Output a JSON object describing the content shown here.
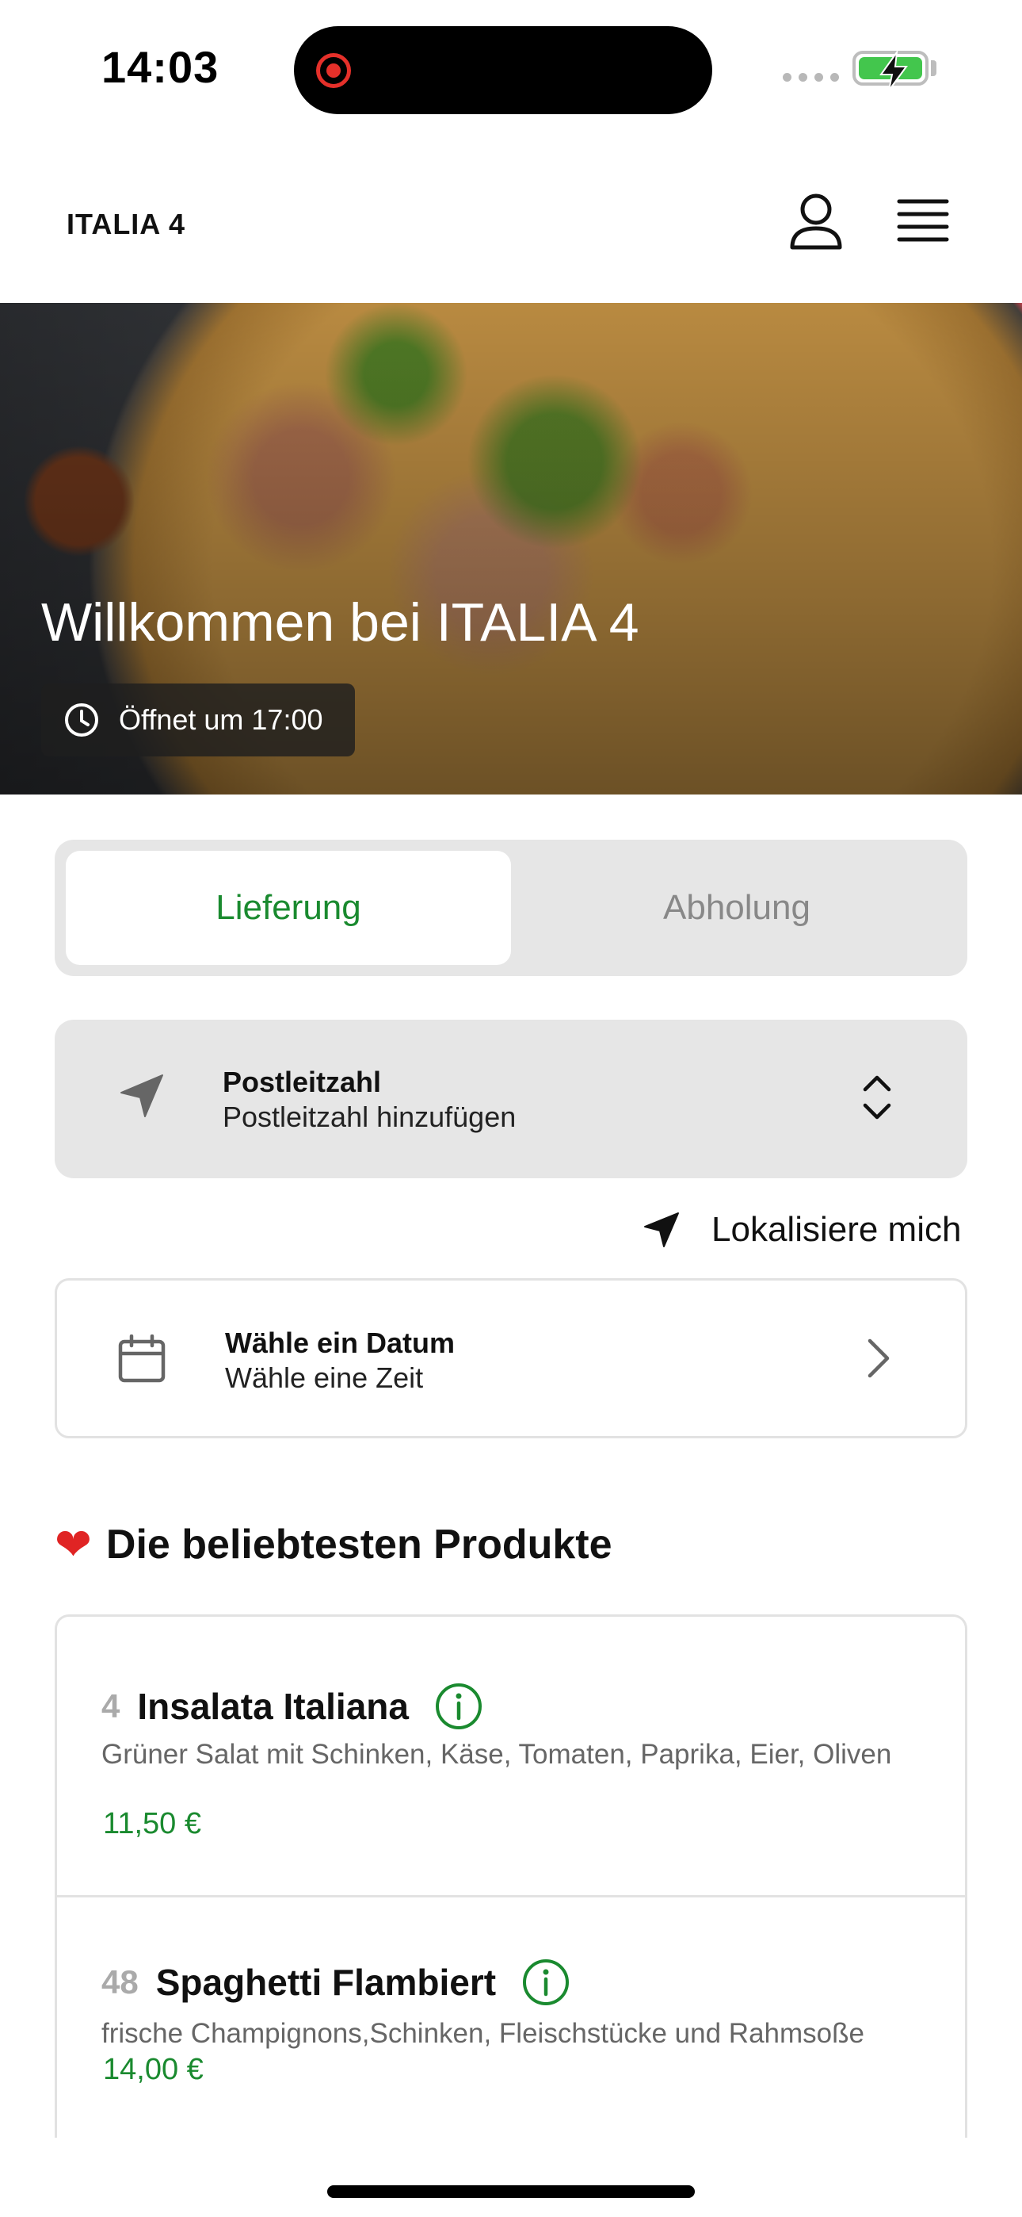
{
  "status_bar": {
    "time": "14:03"
  },
  "header": {
    "brand": "ITALIA 4",
    "account_icon": "person-icon",
    "menu_icon": "hamburger-icon"
  },
  "hero": {
    "title": "Willkommen bei ITALIA 4",
    "opening_text": "Öffnet um 17:00",
    "clock_icon": "clock-icon"
  },
  "mode_toggle": {
    "options": [
      "Lieferung",
      "Abholung"
    ],
    "selected": "Lieferung",
    "active_color": "#1a8a2f"
  },
  "postal": {
    "title": "Postleitzahl",
    "placeholder": "Postleitzahl hinzufügen"
  },
  "locate": {
    "label": "Lokalisiere mich"
  },
  "schedule": {
    "title": "Wähle ein Datum",
    "subtitle": "Wähle eine Zeit"
  },
  "popular": {
    "heading": "Die beliebtesten Produkte",
    "products": [
      {
        "number": "4",
        "name": "Insalata Italiana",
        "description": "Grüner Salat mit Schinken, Käse, Tomaten, Paprika, Eier, Oliven",
        "price": "11,50 €"
      },
      {
        "number": "48",
        "name": "Spaghetti Flambiert",
        "description": "frische Champignons,Schinken, Fleischstücke und Rahmsoße",
        "price": "14,00 €"
      }
    ]
  }
}
